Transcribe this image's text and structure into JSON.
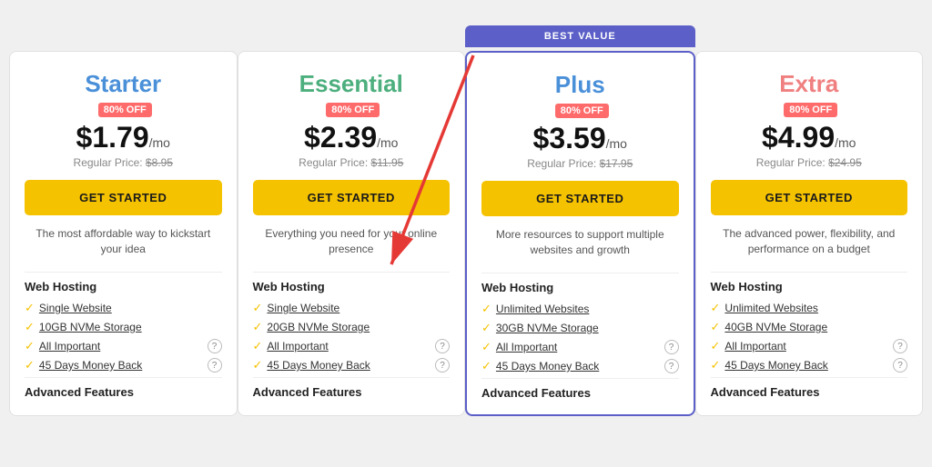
{
  "bestValueBadge": "BEST VALUE",
  "plans": [
    {
      "id": "starter",
      "name": "Starter",
      "nameClass": "starter",
      "discount": "80% OFF",
      "price": "$1.79",
      "period": "/mo",
      "regularPrice": "$8.95",
      "btnLabel": "GET STARTED",
      "description": "The most affordable way to kickstart your idea",
      "isBestValue": false,
      "webHostingTitle": "Web Hosting",
      "features": [
        {
          "text": "Single Website",
          "hasInfo": false
        },
        {
          "text": "10GB NVMe Storage",
          "hasInfo": false
        },
        {
          "text": "All Important",
          "hasInfo": true
        },
        {
          "text": "45 Days Money Back",
          "hasInfo": true
        }
      ],
      "advancedTitle": "Advanced Features"
    },
    {
      "id": "essential",
      "name": "Essential",
      "nameClass": "essential",
      "discount": "80% OFF",
      "price": "$2.39",
      "period": "/mo",
      "regularPrice": "$11.95",
      "btnLabel": "GET STARTED",
      "description": "Everything you need for your online presence",
      "isBestValue": false,
      "webHostingTitle": "Web Hosting",
      "features": [
        {
          "text": "Single Website",
          "hasInfo": false
        },
        {
          "text": "20GB NVMe Storage",
          "hasInfo": false
        },
        {
          "text": "All Important",
          "hasInfo": true
        },
        {
          "text": "45 Days Money Back",
          "hasInfo": true
        }
      ],
      "advancedTitle": "Advanced Features"
    },
    {
      "id": "plus",
      "name": "Plus",
      "nameClass": "plus",
      "discount": "80% OFF",
      "price": "$3.59",
      "period": "/mo",
      "regularPrice": "$17.95",
      "btnLabel": "GET STARTED",
      "description": "More resources to support multiple websites and growth",
      "isBestValue": true,
      "webHostingTitle": "Web Hosting",
      "features": [
        {
          "text": "Unlimited Websites",
          "hasInfo": false
        },
        {
          "text": "30GB NVMe Storage",
          "hasInfo": false
        },
        {
          "text": "All Important",
          "hasInfo": true
        },
        {
          "text": "45 Days Money Back",
          "hasInfo": true
        }
      ],
      "advancedTitle": "Advanced Features"
    },
    {
      "id": "extra",
      "name": "Extra",
      "nameClass": "extra",
      "discount": "80% OFF",
      "price": "$4.99",
      "period": "/mo",
      "regularPrice": "$24.95",
      "btnLabel": "GET STARTED",
      "description": "The advanced power, flexibility, and performance on a budget",
      "isBestValue": false,
      "webHostingTitle": "Web Hosting",
      "features": [
        {
          "text": "Unlimited Websites",
          "hasInfo": false
        },
        {
          "text": "40GB NVMe Storage",
          "hasInfo": false
        },
        {
          "text": "All Important",
          "hasInfo": true
        },
        {
          "text": "45 Days Money Back",
          "hasInfo": true
        }
      ],
      "advancedTitle": "Advanced Features"
    }
  ]
}
